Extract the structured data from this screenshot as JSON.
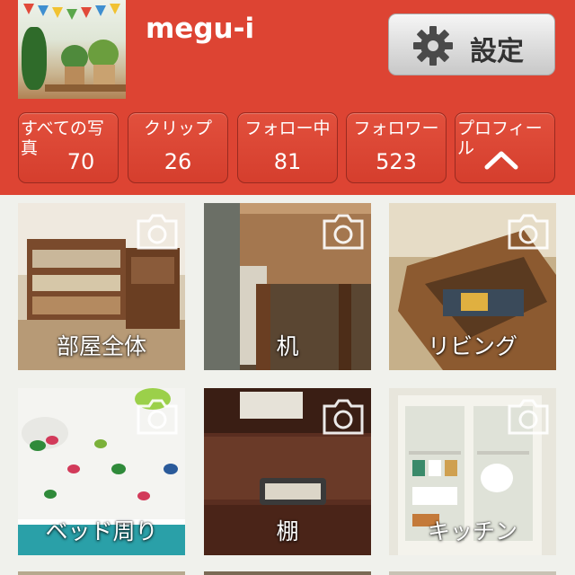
{
  "profile": {
    "username": "megu-i",
    "avatar_icon": "profile-photo"
  },
  "settings": {
    "label": "設定",
    "icon": "gear-icon"
  },
  "stats": [
    {
      "label": "すべての写真",
      "value": "70"
    },
    {
      "label": "クリップ",
      "value": "26"
    },
    {
      "label": "フォロー中",
      "value": "81"
    },
    {
      "label": "フォロワー",
      "value": "523"
    },
    {
      "label": "プロフィール",
      "icon": "chevron-up-icon"
    }
  ],
  "albums": [
    {
      "caption": "部屋全体",
      "icon": "camera-icon"
    },
    {
      "caption": "机",
      "icon": "camera-icon"
    },
    {
      "caption": "リビング",
      "icon": "camera-icon"
    },
    {
      "caption": "ベッド周り",
      "icon": "camera-icon"
    },
    {
      "caption": "棚",
      "icon": "camera-icon"
    },
    {
      "caption": "キッチン",
      "icon": "camera-icon"
    }
  ],
  "colors": {
    "header": "#dd4433",
    "background": "#f0f1ec"
  }
}
